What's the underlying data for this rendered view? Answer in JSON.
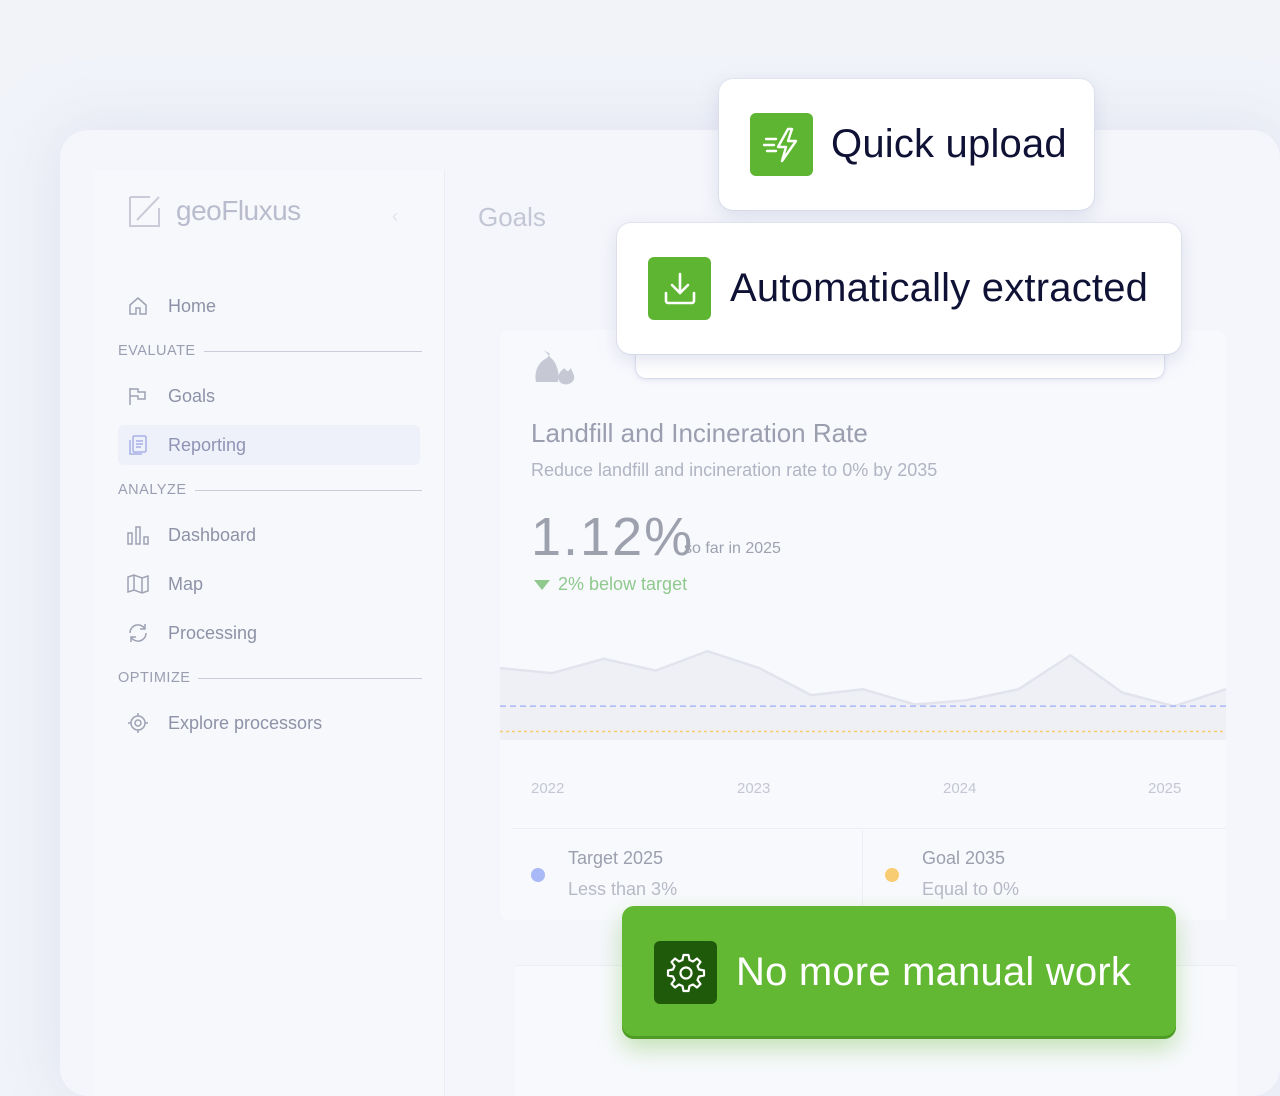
{
  "app": {
    "logo_text": "geoFluxus",
    "page_title": "Goals"
  },
  "sidebar": {
    "home": "Home",
    "sections": [
      {
        "label": "EVALUATE",
        "items": [
          "Goals",
          "Reporting"
        ]
      },
      {
        "label": "ANALYZE",
        "items": [
          "Dashboard",
          "Map",
          "Processing"
        ]
      },
      {
        "label": "OPTIMIZE",
        "items": [
          "Explore processors"
        ]
      }
    ],
    "active_item": "Reporting"
  },
  "goal": {
    "title": "Landfill and Incineration Rate",
    "subtitle": "Reduce landfill and incineration rate to 0% by 2035",
    "value": "1.12%",
    "value_caption": "so far in 2025",
    "trend": "2% below target"
  },
  "chart_data": {
    "type": "line",
    "x": [
      "2022",
      "2023",
      "2024",
      "2025"
    ],
    "x_ticks": [
      "2022",
      "2023",
      "2024",
      "2025"
    ],
    "series_points": [
      7.5,
      6.9,
      8.6,
      7.2,
      9.5,
      7.5,
      4.3,
      5.0,
      3.2,
      3.7,
      5.0,
      9.0,
      4.6,
      3.0,
      5.0
    ],
    "target_line": 3,
    "goal_line": 0,
    "ylim": [
      -1,
      12
    ]
  },
  "legend": [
    {
      "title": "Target 2025",
      "subtitle": "Less than 3%",
      "color": "#a9b8f6"
    },
    {
      "title": "Goal 2035",
      "subtitle": "Equal to 0%",
      "color": "#f8cc72"
    }
  ],
  "popups": {
    "quick_upload": "Quick upload",
    "auto_extracted": "Automatically extracted",
    "no_manual": "No more manual work"
  },
  "colors": {
    "accent_green": "#62b832",
    "dark_green": "#1f5a0b"
  }
}
